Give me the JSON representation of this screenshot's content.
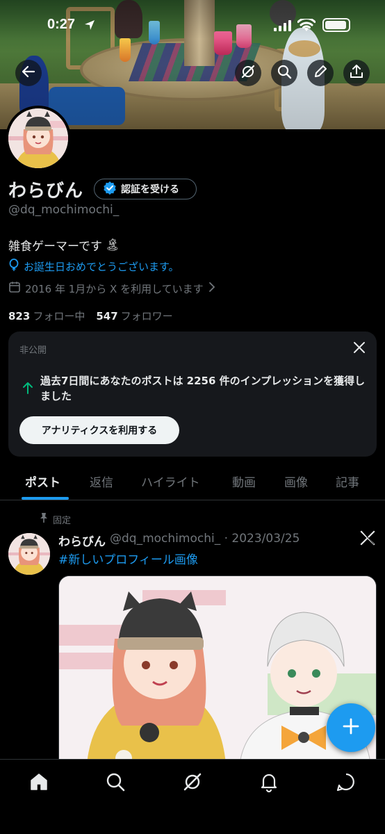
{
  "status_bar": {
    "time": "0:27"
  },
  "profile": {
    "display_name": "わらびん",
    "verify_label": "認証を受ける",
    "handle": "@dq_mochimochi_",
    "bio": "雑食ゲーマーです",
    "bio_emoji": "🏝",
    "birthday": "お誕生日おめでとうございます。",
    "joined": "2016 年 1月から X を利用しています",
    "following_count": "823",
    "following_label": "フォロー中",
    "followers_count": "547",
    "followers_label": "フォロワー"
  },
  "private_card": {
    "label": "非公開",
    "message": "過去7日間にあなたのポストは 2256 件のインプレッションを獲得しました",
    "button_label": "アナリティクスを利用する"
  },
  "tabs": [
    {
      "label": "ポスト",
      "active": true
    },
    {
      "label": "返信"
    },
    {
      "label": "ハイライト"
    },
    {
      "label": "動画"
    },
    {
      "label": "画像"
    },
    {
      "label": "記事"
    }
  ],
  "pinned_post": {
    "pinned_label": "固定",
    "author_name": "わらびん",
    "meta": "@dq_mochimochi_ · 2023/03/25",
    "hashtag": "#新しいプロフィール画像"
  },
  "colors": {
    "accent": "#1d9bf0",
    "background": "#000000",
    "card": "#16181c",
    "secondary_text": "#71767b",
    "positive_arrow": "#00ba7c"
  },
  "icons": {
    "banner_buttons": [
      "back-arrow-icon",
      "grok-icon",
      "search-icon",
      "edit-pencil-icon",
      "share-icon"
    ],
    "bottom_nav": [
      "home-icon",
      "search-icon",
      "grok-icon",
      "notifications-bell-icon",
      "messages-icon"
    ],
    "fab": "compose-plus-icon"
  }
}
